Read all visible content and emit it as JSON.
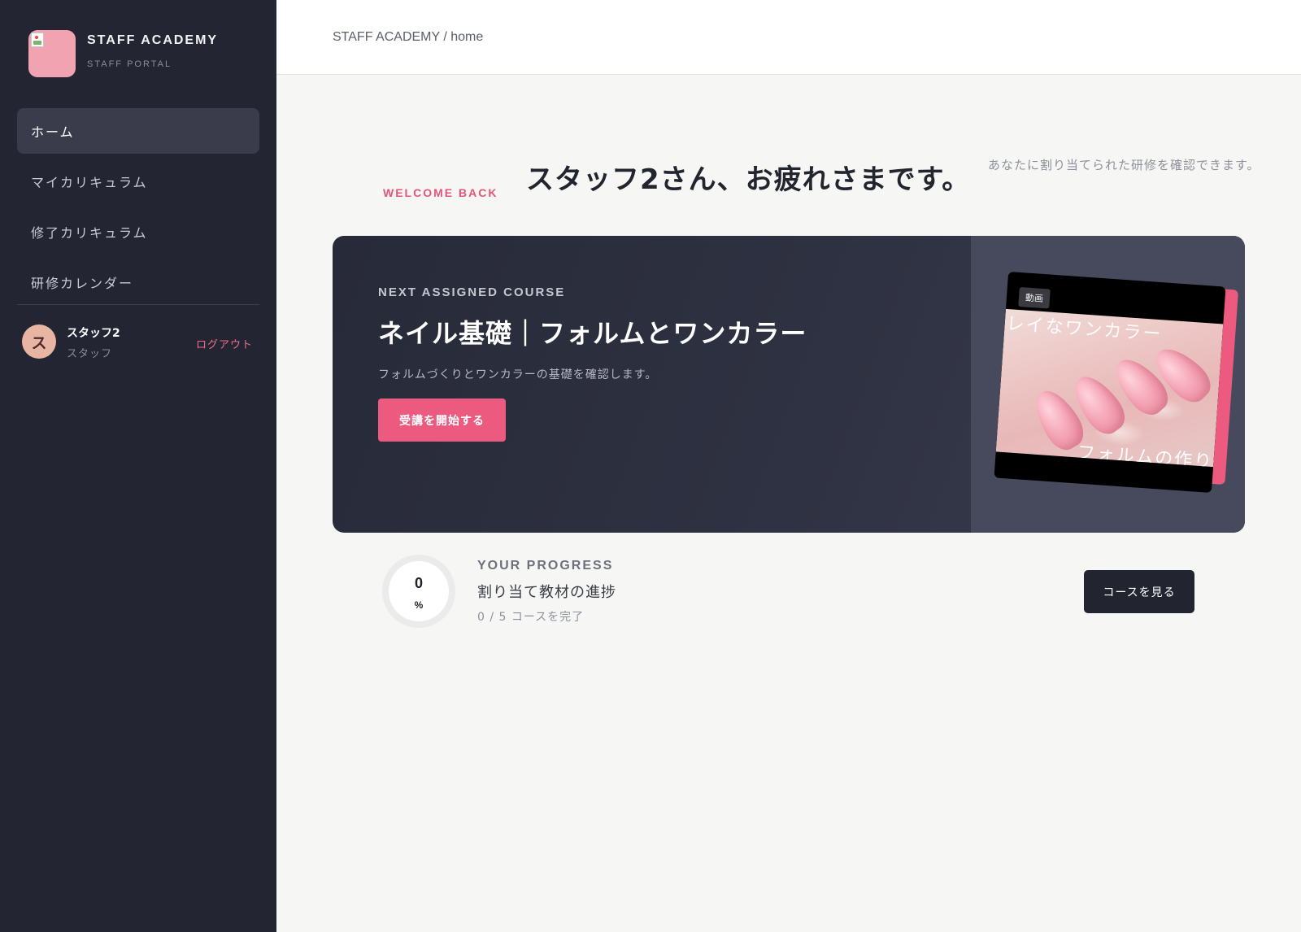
{
  "brand": {
    "name": "STAFF ACADEMY",
    "subtitle": "STAFF PORTAL",
    "logo_icon": "broken-image-icon"
  },
  "sidebar": {
    "items": [
      {
        "label": "ホーム",
        "active": true
      },
      {
        "label": "マイカリキュラム",
        "active": false
      },
      {
        "label": "修了カリキュラム",
        "active": false
      },
      {
        "label": "研修カレンダー",
        "active": false
      }
    ]
  },
  "user": {
    "initial": "ス",
    "name": "スタッフ2",
    "role": "スタッフ",
    "logout_label": "ログアウト"
  },
  "header": {
    "breadcrumb": "STAFF ACADEMY / home"
  },
  "welcome": {
    "eyebrow": "WELCOME BACK",
    "title": "スタッフ2さん、お疲れさまです。",
    "description": "あなたに割り当てられた研修を確認できます。"
  },
  "next_course": {
    "eyebrow": "NEXT ASSIGNED COURSE",
    "title": "ネイル基礎｜フォルムとワンカラー",
    "description": "フォルムづくりとワンカラーの基礎を確認します。",
    "start_label": "受講を開始する",
    "thumbnail": {
      "badge": "動画",
      "caption_top": "レイなワンカラー",
      "caption_bottom": "フォルムの作り"
    }
  },
  "progress": {
    "eyebrow": "YOUR PROGRESS",
    "title": "割り当て教材の進捗",
    "percent": "0",
    "percent_unit": "%",
    "completed": 0,
    "total": 5,
    "count_text": "0 / 5 コースを完了",
    "button_label": "コースを見る"
  },
  "colors": {
    "sidebar_bg": "#232532",
    "accent": "#ec5b7f",
    "dark_button": "#22242f"
  }
}
